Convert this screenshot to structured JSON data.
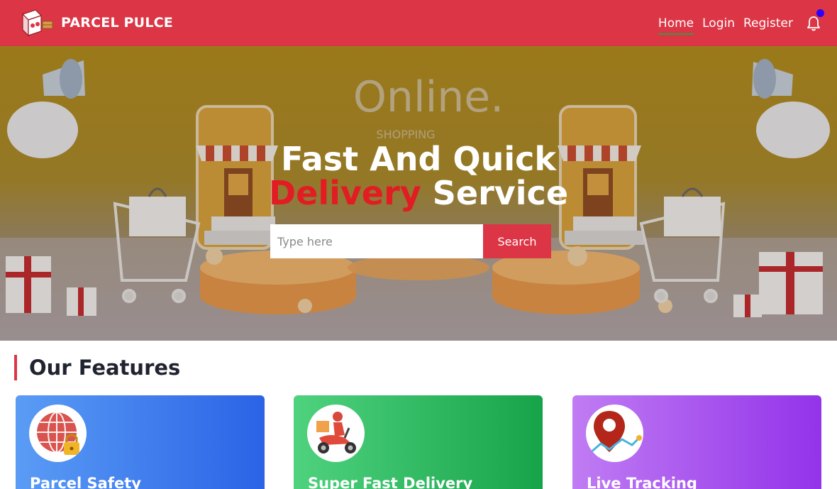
{
  "brand": {
    "name": "PARCEL PULCE"
  },
  "nav": {
    "links": [
      "Home",
      "Login",
      "Register"
    ],
    "active": "Home"
  },
  "hero": {
    "title_line1": "Fast And Quick",
    "title_accent": "Delivery",
    "title_rest": " Service",
    "background_sign": "Online.",
    "background_subtext": "SHOPPING",
    "search": {
      "placeholder": "Type here",
      "button_label": "Search"
    }
  },
  "features": {
    "heading": "Our Features",
    "cards": [
      {
        "title": "Parcel Safety",
        "icon": "globe-lock-icon"
      },
      {
        "title": "Super Fast Delivery",
        "icon": "scooter-courier-icon"
      },
      {
        "title": "Live Tracking",
        "icon": "map-pin-icon"
      }
    ]
  },
  "colors": {
    "navbar": "#dc3545",
    "accent_red": "#e21c23",
    "active_underline": "#2f9e44",
    "notification_dot": "#2b00ff"
  }
}
